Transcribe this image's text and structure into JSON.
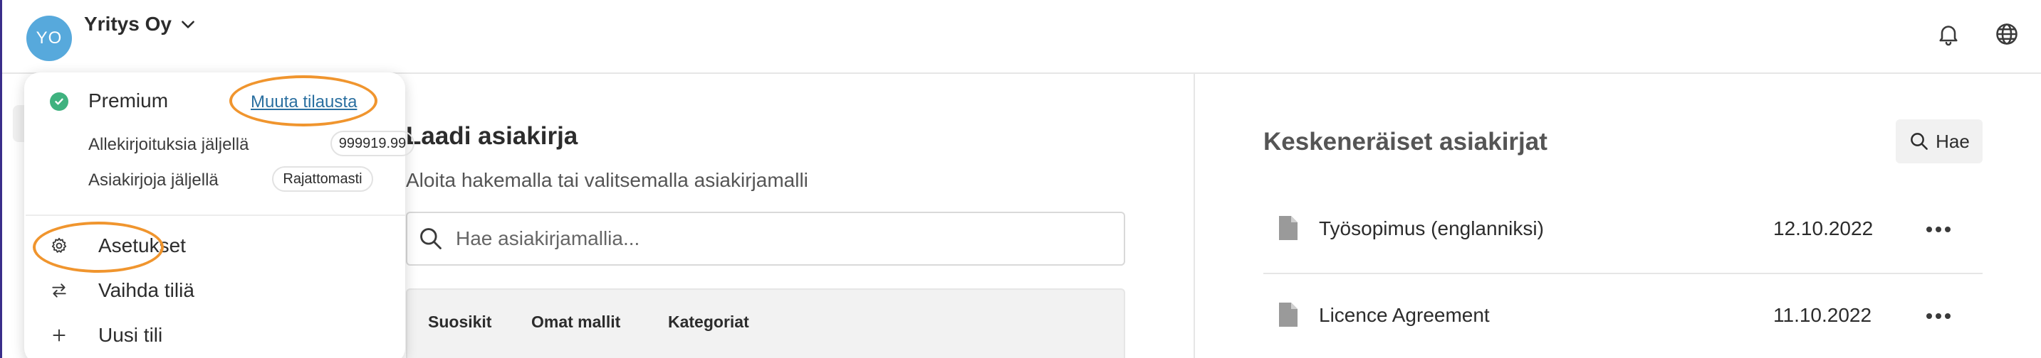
{
  "header": {
    "avatar_initials": "YO",
    "company_name": "Yritys Oy",
    "icons": [
      "bell-icon",
      "globe-icon"
    ]
  },
  "account_menu": {
    "plan_name": "Premium",
    "change_plan_link": "Muuta tilausta",
    "signatures_label": "Allekirjoituksia jäljellä",
    "signatures_value": "999919.99",
    "documents_label": "Asiakirjoja jäljellä",
    "documents_value": "Rajattomasti",
    "items": [
      {
        "label": "Asetukset",
        "icon": "gear-icon"
      },
      {
        "label": "Vaihda tiliä",
        "icon": "switch-arrows-icon"
      },
      {
        "label": "Uusi tili",
        "icon": "plus-icon"
      }
    ]
  },
  "create_document": {
    "title": "Laadi asiakirja",
    "subtitle": "Aloita hakemalla tai valitsemalla asiakirjamalli",
    "search_placeholder": "Hae asiakirjamallia...",
    "tabs": [
      "Suosikit",
      "Omat mallit",
      "Kategoriat"
    ]
  },
  "drafts": {
    "title": "Keskeneräiset asiakirjat",
    "search_button": "Hae",
    "rows": [
      {
        "name": "Työsopimus (englanniksi)",
        "date": "12.10.2022"
      },
      {
        "name": "Licence Agreement",
        "date": "11.10.2022"
      }
    ]
  },
  "colors": {
    "accent_purple": "#3a2d8a",
    "avatar_blue": "#57a9dc",
    "success_green": "#3fb27f",
    "highlight_orange": "#f0952e",
    "link_blue": "#2a6fa0"
  }
}
